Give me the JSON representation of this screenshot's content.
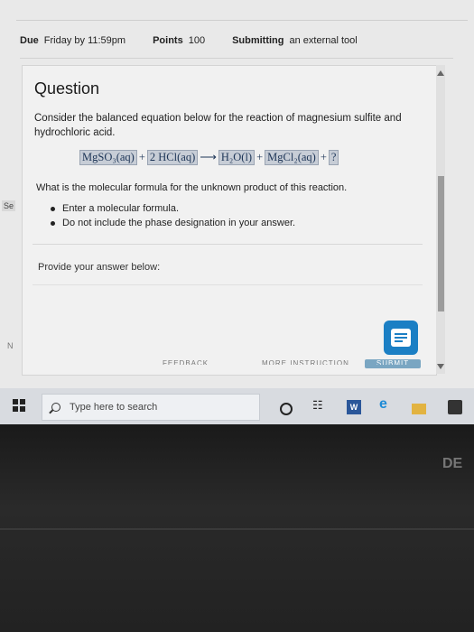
{
  "header": {
    "due_label": "Due",
    "due_value": "Friday by 11:59pm",
    "points_label": "Points",
    "points_value": "100",
    "submitting_label": "Submitting",
    "submitting_value": "an external tool"
  },
  "question": {
    "title": "Question",
    "prompt": "Consider the balanced equation below for the reaction of magnesium sulfite and hydrochloric acid.",
    "equation": {
      "reactant1": "MgSO₃(aq)",
      "plus1": "+",
      "reactant2": "2 HCl(aq)",
      "arrow": "⟶",
      "product1": "H₂O(l)",
      "plus2": "+",
      "product2": "MgCl₂(aq)",
      "plus3": "+",
      "product3": "?"
    },
    "sub_question": "What is the molecular formula for the unknown product of this reaction.",
    "instructions": [
      "Enter a molecular formula.",
      "Do not include the phase designation in your answer."
    ],
    "answer_prompt": "Provide your answer below:"
  },
  "cut_off": {
    "feedback": "FEEDBACK",
    "more_instruction": "MORE INSTRUCTION",
    "submit": "SUBMIT"
  },
  "side": {
    "left_tab": "Se",
    "left_marker": "N"
  },
  "taskbar": {
    "search_placeholder": "Type here to search",
    "word_label": "W",
    "task_view_glyph": "☷"
  },
  "bezel": {
    "logo": "DE"
  },
  "colors": {
    "equation_box": "#c7cdd6",
    "chat_button": "#1b7fc4",
    "word_icon": "#2b579a"
  }
}
